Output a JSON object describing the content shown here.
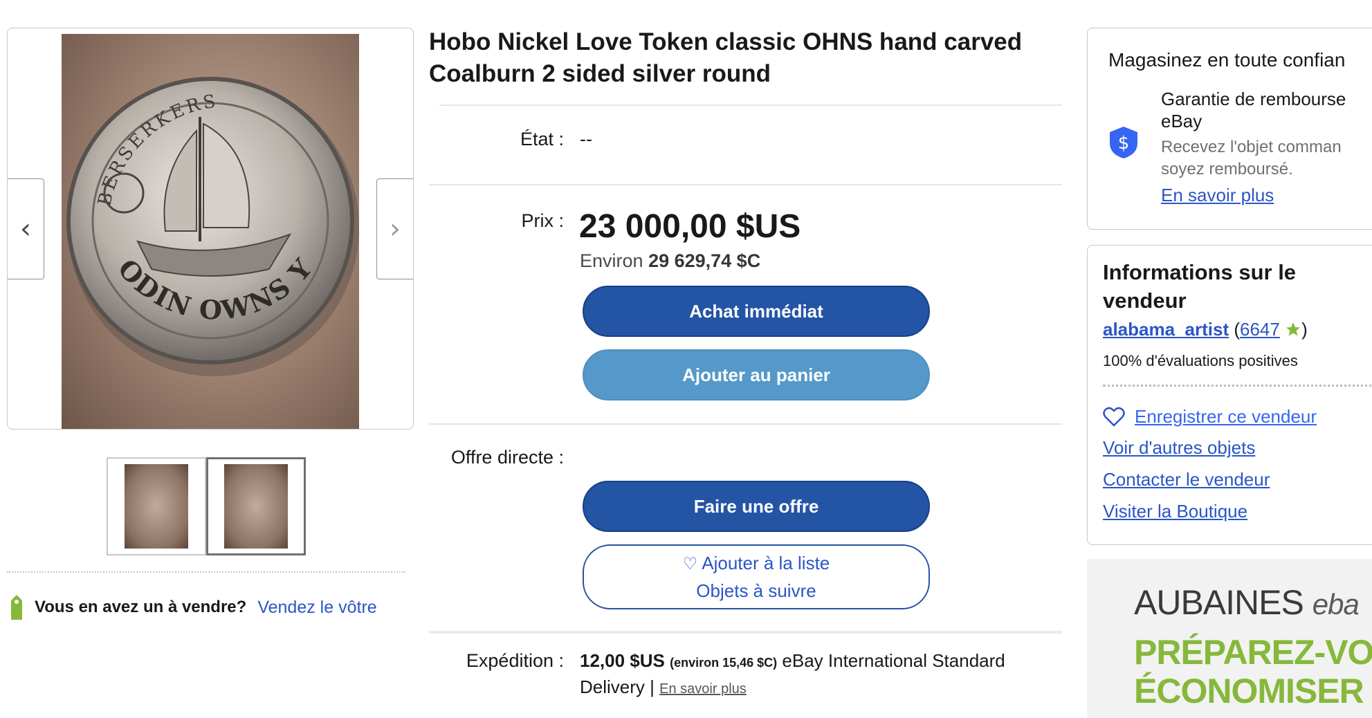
{
  "gallery": {
    "prev_arrow": "‹",
    "next_arrow": "›",
    "photo_text": {
      "top_arc": "BERSERKERS",
      "bottom_arc": "ODIN OWNS YE ALL"
    },
    "thumbnail_count": 2,
    "selected_thumbnail": 2
  },
  "sell": {
    "question": "Vous en avez un à vendre?",
    "link": "Vendez le vôtre"
  },
  "listing": {
    "title": "Hobo Nickel Love Token classic OHNS hand carved Coalburn 2 sided silver round",
    "condition_label": "État :",
    "condition_value": "--",
    "price_label": "Prix :",
    "price": "23 000,00 $US",
    "approx_prefix": "Environ",
    "approx_value": "29 629,74 $C",
    "buy_now": "Achat immédiat",
    "add_to_cart": "Ajouter au panier",
    "offer_label": "Offre directe :",
    "make_offer": "Faire une offre",
    "watchlist_line1": "Ajouter à la liste",
    "watchlist_line2": "Objets à suivre",
    "shipping_label": "Expédition :",
    "shipping_price": "12,00 $US",
    "shipping_approx": "(environ 15,46 $C)",
    "shipping_service": "eBay International Standard",
    "shipping_service2": "Delivery",
    "shipping_sep": "|",
    "shipping_more": "En savoir plus"
  },
  "trust": {
    "title": "Magasinez en toute confian",
    "guarantee_title": "Garantie de rembourse eBay",
    "guarantee_desc_line1": "Recevez l'objet comman",
    "guarantee_desc_line2": "soyez remboursé.",
    "learn_more": "En savoir plus"
  },
  "seller": {
    "heading": "Informations sur le vendeur",
    "name": "alabama_artist",
    "open_paren": "(",
    "score": "6647",
    "close_paren": ")",
    "feedback": "100% d'évaluations positives",
    "save_seller": "Enregistrer ce vendeur",
    "other_items": "Voir d'autres objets",
    "contact": "Contacter le vendeur",
    "store": "Visiter la Boutique"
  },
  "promo": {
    "brand": "AUBAINES",
    "brand_suffix": "eba",
    "line1": "PRÉPAREZ-VOUS",
    "line2": "ÉCONOMISER GR"
  },
  "colors": {
    "primary_button": "#2454a4",
    "secondary_button": "#5499c9",
    "link": "#2a55c6",
    "promo_green": "#86b83a"
  }
}
